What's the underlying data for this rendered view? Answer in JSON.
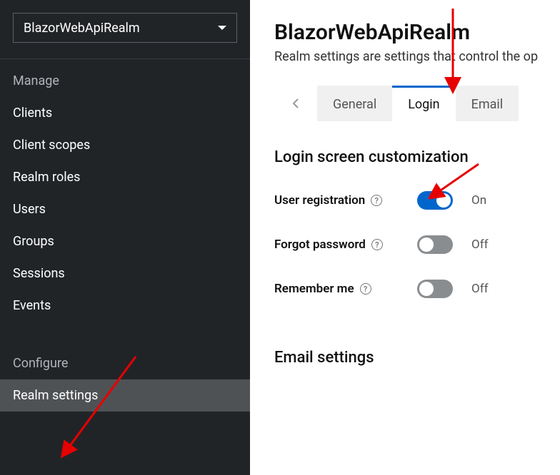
{
  "sidebar": {
    "realmName": "BlazorWebApiRealm",
    "sections": {
      "manage": {
        "label": "Manage",
        "items": [
          "Clients",
          "Client scopes",
          "Realm roles",
          "Users",
          "Groups",
          "Sessions",
          "Events"
        ]
      },
      "configure": {
        "label": "Configure",
        "items": [
          "Realm settings"
        ]
      }
    },
    "activeItem": "Realm settings"
  },
  "main": {
    "title": "BlazorWebApiRealm",
    "description": "Realm settings are settings that control the op",
    "tabs": {
      "items": [
        "General",
        "Login",
        "Email"
      ],
      "active": "Login"
    },
    "loginSection": {
      "title": "Login screen customization",
      "settings": [
        {
          "label": "User registration",
          "state": "On",
          "on": true
        },
        {
          "label": "Forgot password",
          "state": "Off",
          "on": false
        },
        {
          "label": "Remember me",
          "state": "Off",
          "on": false
        }
      ]
    },
    "emailSection": {
      "title": "Email settings"
    }
  }
}
